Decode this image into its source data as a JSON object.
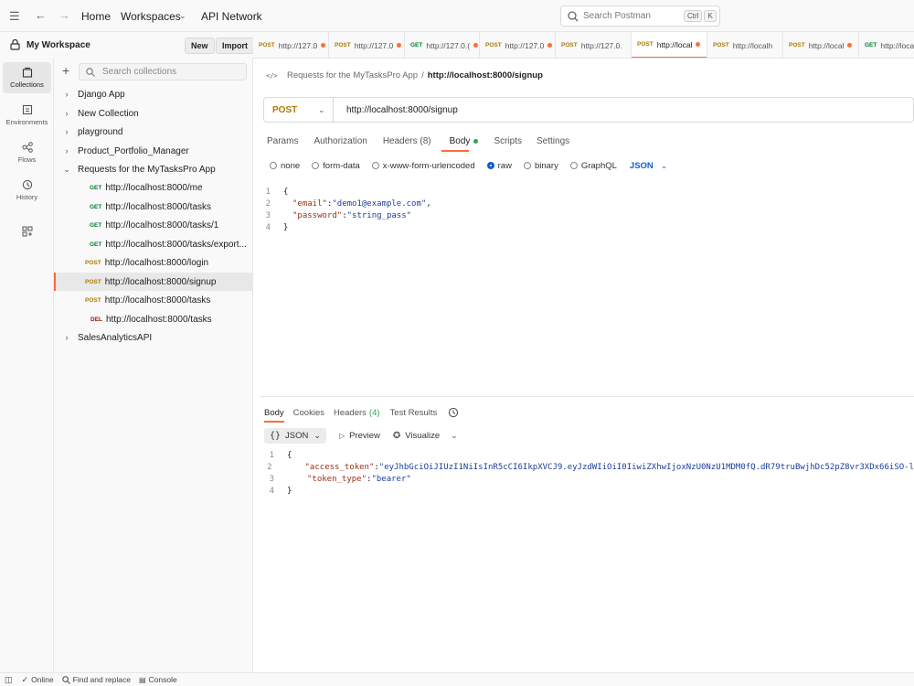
{
  "topbar": {
    "home": "Home",
    "workspaces": "Workspaces",
    "api_network": "API Network",
    "search_placeholder": "Search Postman",
    "shortcut_ctrl": "Ctrl",
    "shortcut_k": "K"
  },
  "workspace": {
    "title": "My Workspace",
    "new_label": "New",
    "import_label": "Import"
  },
  "rail": [
    {
      "label": "Collections",
      "icon": "collections-icon"
    },
    {
      "label": "Environments",
      "icon": "environments-icon"
    },
    {
      "label": "Flows",
      "icon": "flows-icon"
    },
    {
      "label": "History",
      "icon": "history-icon"
    }
  ],
  "sidebar": {
    "search_placeholder": "Search collections",
    "collections": [
      {
        "label": "Django App"
      },
      {
        "label": "New Collection"
      },
      {
        "label": "playground"
      },
      {
        "label": "Product_Portfolio_Manager"
      },
      {
        "label": "Requests for the MyTasksPro App"
      }
    ],
    "requests": [
      {
        "method": "GET",
        "url": "http://localhost:8000/me"
      },
      {
        "method": "GET",
        "url": "http://localhost:8000/tasks"
      },
      {
        "method": "GET",
        "url": "http://localhost:8000/tasks/1"
      },
      {
        "method": "GET",
        "url": "http://localhost:8000/tasks/export..."
      },
      {
        "method": "POST",
        "url": "http://localhost:8000/login"
      },
      {
        "method": "POST",
        "url": "http://localhost:8000/signup"
      },
      {
        "method": "POST",
        "url": "http://localhost:8000/tasks"
      },
      {
        "method": "DEL",
        "url": "http://localhost:8000/tasks"
      }
    ],
    "last_collection": "SalesAnalyticsAPI"
  },
  "tabs": [
    {
      "method": "POST",
      "label": "http://127.0"
    },
    {
      "method": "POST",
      "label": "http://127.0"
    },
    {
      "method": "GET",
      "label": "http://127.0.("
    },
    {
      "method": "POST",
      "label": "http://127.0"
    },
    {
      "method": "POST",
      "label": "http://127.0."
    },
    {
      "method": "POST",
      "label": "http://local"
    },
    {
      "method": "POST",
      "label": "http://localh"
    },
    {
      "method": "POST",
      "label": "http://local"
    },
    {
      "method": "GET",
      "label": "http://loca"
    }
  ],
  "request": {
    "breadcrumb_collection": "Requests for the MyTasksPro App",
    "breadcrumb_sep": "/",
    "breadcrumb_request": "http://localhost:8000/signup",
    "method": "POST",
    "url": "http://localhost:8000/signup",
    "subtabs": [
      "Params",
      "Authorization",
      "Headers (8)",
      "Body",
      "Scripts",
      "Settings"
    ],
    "body_types": [
      "none",
      "form-data",
      "x-www-form-urlencoded",
      "raw",
      "binary",
      "GraphQL"
    ],
    "body_format": "JSON",
    "body_lines": [
      {
        "n": "1",
        "text": "{"
      },
      {
        "n": "2",
        "key": "\"email\"",
        "sep": ": ",
        "val": "\"demo1@example.com\"",
        "end": ","
      },
      {
        "n": "3",
        "key": "\"password\"",
        "sep": ": ",
        "val": "\"string_pass\"",
        "end": ""
      },
      {
        "n": "4",
        "text": "}"
      }
    ]
  },
  "response": {
    "tabs": [
      "Body",
      "Cookies",
      "Headers",
      "Test Results"
    ],
    "headers_count": "(4)",
    "format": "JSON",
    "preview": "Preview",
    "visualize": "Visualize",
    "lines": [
      {
        "n": "1",
        "text": "{"
      },
      {
        "n": "2",
        "key": "\"access_token\"",
        "sep": ": ",
        "val": "\"eyJhbGciOiJIUzI1NiIsInR5cCI6IkpXVCJ9.eyJzdWIiOiI0IiwiZXhwIjoxNzU0NzU1MDM0fQ.dR79truBwjhDc52pZ8vr3XDx66iSO-l",
        "end": ""
      },
      {
        "n": "3",
        "key": "\"token_type\"",
        "sep": ": ",
        "val": "\"bearer\"",
        "end": ""
      },
      {
        "n": "4",
        "text": "}"
      }
    ]
  },
  "statusbar": {
    "online": "Online",
    "find_replace": "Find and replace",
    "console": "Console"
  },
  "colors": {
    "accent": "#ff6c37",
    "get": "#007f31",
    "post": "#ad7a03",
    "delete": "#8e1a10",
    "link": "#0b5ed7"
  }
}
